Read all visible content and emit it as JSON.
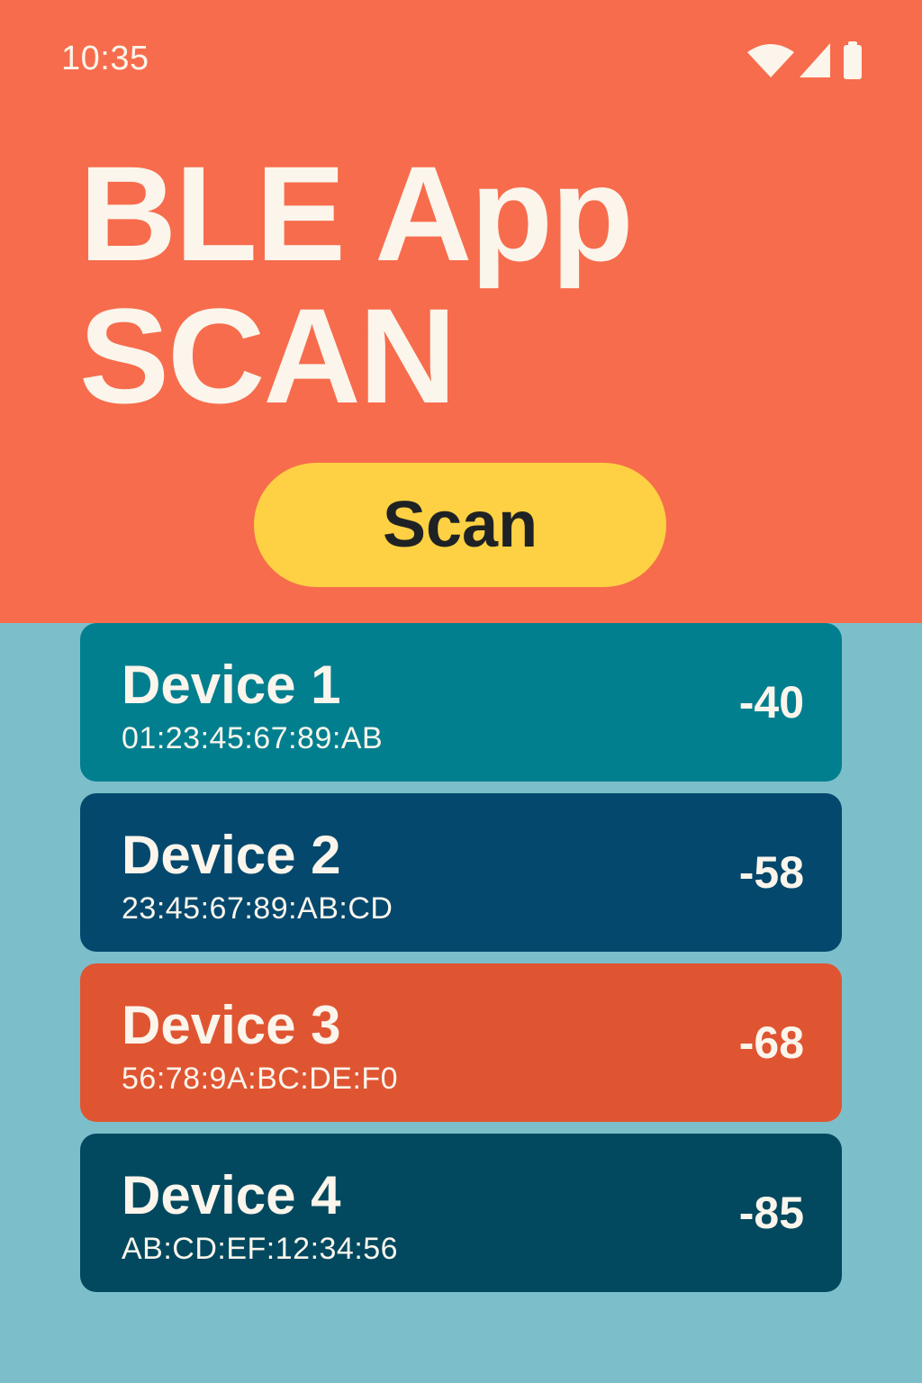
{
  "status_bar": {
    "time": "10:35",
    "icons": [
      "wifi-icon",
      "cellular-signal-icon",
      "battery-icon"
    ]
  },
  "header": {
    "title_line1": "BLE App",
    "title_line2": "SCAN",
    "scan_button_label": "Scan"
  },
  "colors": {
    "header_bg": "#f76c4c",
    "list_bg": "#7cbfca",
    "scan_button_bg": "#fdd143",
    "text_light": "#fbf5ec"
  },
  "devices": [
    {
      "name": "Device 1",
      "mac": "01:23:45:67:89:AB",
      "rssi": "-40",
      "color": "#027f8f"
    },
    {
      "name": "Device 2",
      "mac": "23:45:67:89:AB:CD",
      "rssi": "-58",
      "color": "#04486d"
    },
    {
      "name": "Device 3",
      "mac": "56:78:9A:BC:DE:F0",
      "rssi": "-68",
      "color": "#df5532"
    },
    {
      "name": "Device 4",
      "mac": "AB:CD:EF:12:34:56",
      "rssi": "-85",
      "color": "#02495f"
    }
  ]
}
